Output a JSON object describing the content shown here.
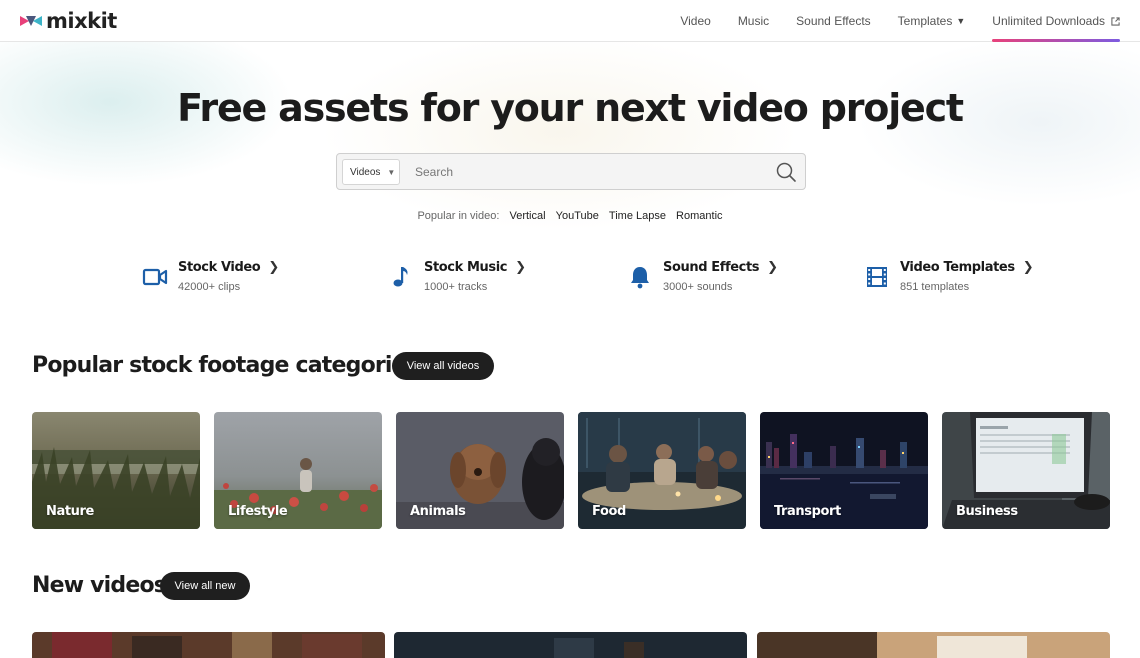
{
  "header": {
    "logo_text": "mixkit",
    "nav": [
      {
        "label": "Video"
      },
      {
        "label": "Music"
      },
      {
        "label": "Sound Effects"
      },
      {
        "label": "Templates"
      },
      {
        "label": "Unlimited Downloads"
      }
    ]
  },
  "hero": {
    "title": "Free assets for your next video project",
    "search": {
      "type_value": "Videos",
      "placeholder": "Search"
    },
    "popular_label": "Popular in video:",
    "popular_tags": [
      "Vertical",
      "YouTube",
      "Time Lapse",
      "Romantic"
    ]
  },
  "categories": [
    {
      "title": "Stock Video",
      "subtitle": "42000+ clips",
      "icon": "video-camera-icon"
    },
    {
      "title": "Stock Music",
      "subtitle": "1000+ tracks",
      "icon": "music-note-icon"
    },
    {
      "title": "Sound Effects",
      "subtitle": "3000+ sounds",
      "icon": "bell-icon"
    },
    {
      "title": "Video Templates",
      "subtitle": "851 templates",
      "icon": "film-strip-icon"
    }
  ],
  "footage": {
    "title": "Popular stock footage categories",
    "button": "View all videos",
    "cards": [
      "Nature",
      "Lifestyle",
      "Animals",
      "Food",
      "Transport",
      "Business"
    ]
  },
  "new_videos": {
    "title": "New videos",
    "button": "View all new"
  },
  "colors": {
    "accent_blue": "#1d5fa8",
    "pill_bg": "#1f1f1f",
    "active_underline_start": "#e8417a",
    "active_underline_end": "#7d5be0"
  }
}
